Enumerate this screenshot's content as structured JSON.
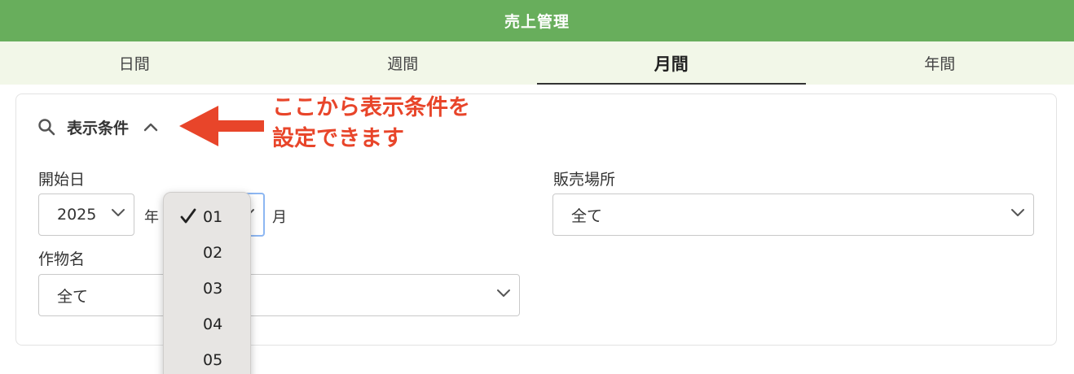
{
  "header": {
    "title": "売上管理",
    "bg_color": "#68ae5c"
  },
  "tabs": [
    {
      "label": "日間",
      "active": false
    },
    {
      "label": "週間",
      "active": false
    },
    {
      "label": "月間",
      "active": true
    },
    {
      "label": "年間",
      "active": false
    }
  ],
  "conditions": {
    "title": "表示条件",
    "search_icon": "search-icon",
    "toggle_icon": "chevron-up-icon"
  },
  "annotation": {
    "line1": "ここから表示条件を",
    "line2": "設定できます",
    "color": "#e8452a"
  },
  "start_date": {
    "label": "開始日",
    "year_value": "2025",
    "year_suffix": "年",
    "month_suffix": "月"
  },
  "month_dropdown": {
    "selected": "01",
    "options": [
      "01",
      "02",
      "03",
      "04",
      "05"
    ]
  },
  "sales_location": {
    "label": "販売場所",
    "value": "全て"
  },
  "crop_name": {
    "label": "作物名",
    "value": "全て"
  }
}
